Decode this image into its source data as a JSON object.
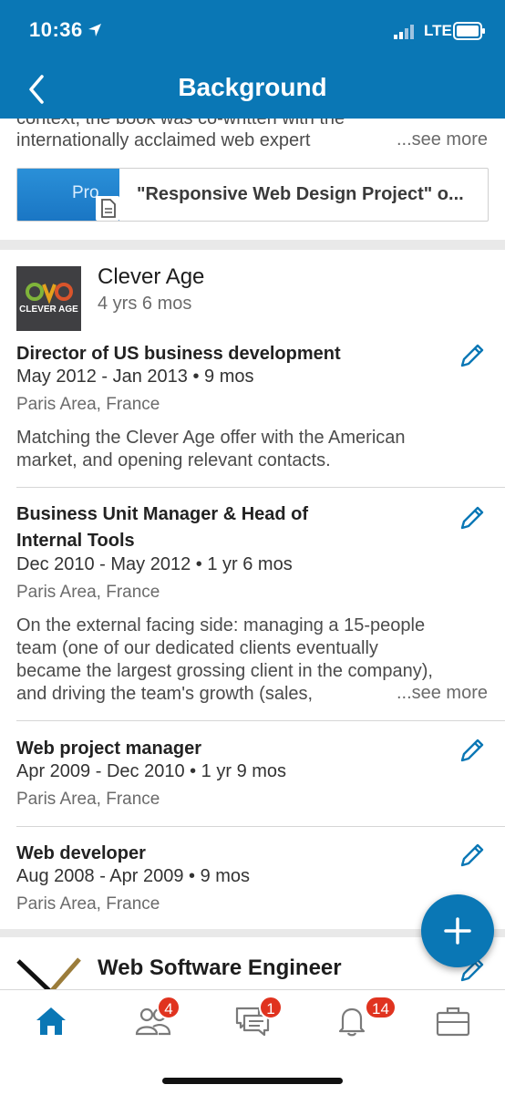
{
  "status_bar": {
    "time": "10:36",
    "network": "LTE"
  },
  "header": {
    "title": "Background"
  },
  "publication": {
    "text_line1": "context, the book was co-written with the",
    "text_line2": "internationally acclaimed web expert",
    "see_more": "...see more",
    "thumbnail_text": "Pro",
    "media_title": "\"Responsive Web Design Project\" o..."
  },
  "company": {
    "logo_text": "CLEVER AGE",
    "name": "Clever Age",
    "duration": "4 yrs 6 mos",
    "positions": [
      {
        "title_line1": "Director of US business development",
        "title_line2": "",
        "dates": "May 2012 - Jan 2013 • 9 mos",
        "location": "Paris Area, France",
        "desc_line1": "Matching the Clever Age offer with the American",
        "desc_line2": "market, and opening relevant contacts."
      },
      {
        "title_line1": "Business Unit Manager & Head of",
        "title_line2": "Internal Tools",
        "dates": "Dec 2010 - May 2012 • 1 yr 6 mos",
        "location": "Paris Area, France",
        "desc_line1": "On the external facing side: managing a 15-people",
        "desc_line2": "team (one of our dedicated clients eventually",
        "desc_line3": "became the largest grossing client in the company),",
        "desc_line4": "and driving the team's growth (sales,",
        "see_more": "...see more"
      },
      {
        "title_line1": "Web project manager",
        "dates": "Apr 2009 - Dec 2010 • 1 yr 9 mos",
        "location": "Paris Area, France"
      },
      {
        "title_line1": "Web developer",
        "dates": "Aug 2008 - Apr 2009 • 9 mos",
        "location": "Paris Area, France"
      }
    ]
  },
  "next_company": {
    "title": "Web Software Engineer"
  },
  "tabbar": {
    "home_label": "Home",
    "network_badge": "4",
    "messages_badge": "1",
    "notifications_badge": "14"
  },
  "colors": {
    "brand": "#0a77b5",
    "badge": "#e0331f",
    "background": "#e9e9e9"
  },
  "icons": [
    "location-arrow-icon",
    "signal-icon",
    "battery-icon",
    "back-chevron-icon",
    "document-icon",
    "pencil-icon",
    "plus-icon",
    "home-icon",
    "people-icon",
    "messages-icon",
    "bell-icon",
    "briefcase-icon"
  ]
}
